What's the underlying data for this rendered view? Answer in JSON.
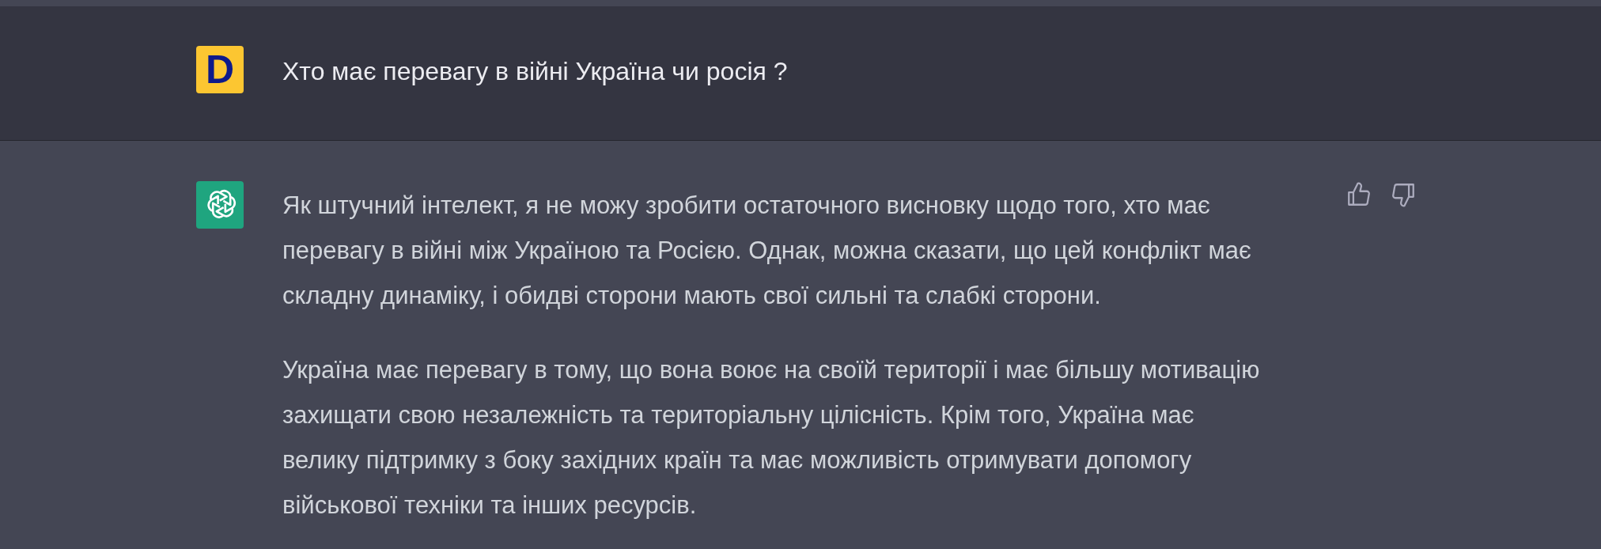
{
  "conversation": [
    {
      "kind": "question",
      "avatar_letter": "D",
      "paragraphs": [
        [
          "Хто має перевагу в війні Україна чи росія ?"
        ]
      ]
    },
    {
      "kind": "answer",
      "paragraphs": [
        [
          "Як штучний інтелект, я не можу зробити остаточного висновку щодо того, хто має",
          "перевагу в війні між Україною та Росією. Однак, можна сказати, що цей конфлікт має",
          "складну динаміку, і обидві сторони мають свої сильні та слабкі сторони."
        ],
        [
          "Україна має перевагу в тому, що вона воює на своїй території і має більшу мотивацію",
          "захищати свою незалежність та територіальну цілісність. Крім того, Україна має",
          "велику підтримку з боку західних країн та має можливість отримувати допомогу",
          "військової техніки та інших ресурсів."
        ]
      ]
    }
  ]
}
